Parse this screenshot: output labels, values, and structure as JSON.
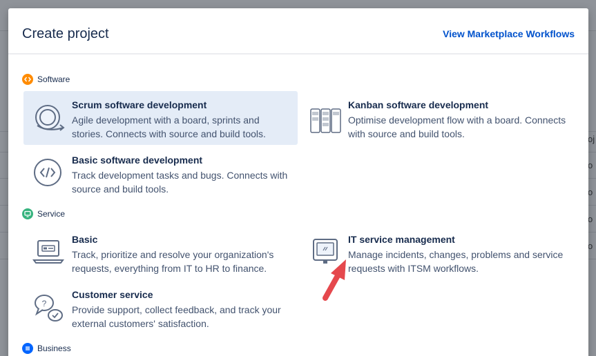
{
  "modal": {
    "title": "Create project",
    "marketplace_link": "View Marketplace Workflows"
  },
  "background": {
    "edge_letters": [
      "oj",
      "o",
      "o",
      "o",
      "o"
    ]
  },
  "sections": [
    {
      "label": "Software",
      "icon": "code-icon",
      "color": "#ff8b00",
      "templates": [
        {
          "title": "Scrum software development",
          "description": "Agile development with a board, sprints and stories. Connects with source and build tools.",
          "icon": "scrum-cycle-icon",
          "selected": true
        },
        {
          "title": "Kanban software development",
          "description": "Optimise development flow with a board. Connects with source and build tools.",
          "icon": "kanban-board-icon",
          "selected": false
        },
        {
          "title": "Basic software development",
          "description": "Track development tasks and bugs. Connects with source and build tools.",
          "icon": "code-brackets-icon",
          "selected": false
        }
      ]
    },
    {
      "label": "Service",
      "icon": "monitor-icon",
      "color": "#36b37e",
      "templates": [
        {
          "title": "Basic",
          "description": "Track, prioritize and resolve your organization's requests, everything from IT to HR to finance.",
          "icon": "laptop-icon",
          "selected": false
        },
        {
          "title": "IT service management",
          "description": "Manage incidents, changes, problems and service requests with ITSM workflows.",
          "icon": "computer-monitor-icon",
          "selected": false
        },
        {
          "title": "Customer service",
          "description": "Provide support, collect feedback, and track your external customers' satisfaction.",
          "icon": "chat-bubbles-icon",
          "selected": false
        }
      ]
    },
    {
      "label": "Business",
      "icon": "list-icon",
      "color": "#0065ff",
      "templates": []
    }
  ],
  "colors": {
    "link": "#0052cc",
    "selected_card": "#e4ecf7",
    "icon_stroke": "#5e6c84",
    "annotation_arrow": "#e5484d"
  }
}
